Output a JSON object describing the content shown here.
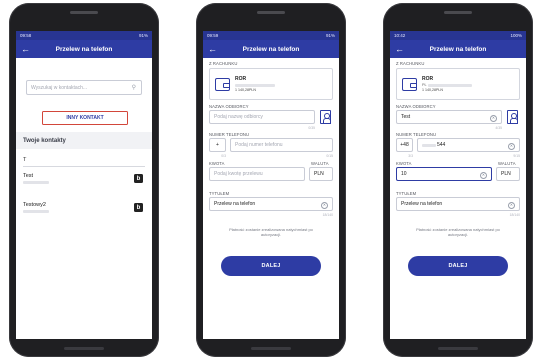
{
  "title": "Przelew na telefon",
  "screen1": {
    "status_time": "09:58",
    "status_right": "91%",
    "search_placeholder": "Wyszukaj w kontaktach...",
    "other_contact_button": "INNY KONTAKT",
    "section_title": "Twoje kontakty",
    "group_letter": "T",
    "contacts": [
      {
        "name": "Test",
        "badge": "b"
      },
      {
        "name": "Testowy2",
        "badge": "b"
      }
    ]
  },
  "screen2": {
    "status_time": "09:59",
    "status_right": "91%",
    "from_account_label": "Z RACHUNKU",
    "account_name": "ROR",
    "account_balance": "1 140,28PLN",
    "recipient_label": "NAZWA ODBIORCY",
    "recipient_placeholder": "Podaj nazwę odbiorcy",
    "recipient_counter": "0/35",
    "phone_label": "NUMER TELEFONU",
    "phone_prefix": "+",
    "phone_placeholder": "Podaj numer telefonu",
    "prefix_counter": "0/3",
    "phone_counter": "0/15",
    "amount_label": "KWOTA",
    "amount_placeholder": "Podaj kwotę przelewu",
    "currency_label": "WALUTA",
    "currency_value": "PLN",
    "title_label": "TYTUŁEM",
    "title_value": "Przelew na telefon",
    "title_counter": "18/140",
    "notice": "Płatność zostanie zrealizowana natychmiast po autoryzacji.",
    "next_button": "DALEJ"
  },
  "screen3": {
    "status_time": "10:42",
    "status_right": "100%",
    "from_account_label": "Z RACHUNKU",
    "account_name": "ROR",
    "account_number": "PL",
    "account_balance": "1 140,28PLN",
    "recipient_label": "NAZWA ODBIORCY",
    "recipient_value": "Test",
    "recipient_counter": "4/35",
    "phone_label": "NUMER TELEFONU",
    "phone_prefix": "+48",
    "phone_value": "544",
    "prefix_counter": "3/3",
    "phone_counter": "9/15",
    "amount_label": "KWOTA",
    "amount_value": "10",
    "currency_label": "WALUTA",
    "currency_value": "PLN",
    "title_label": "TYTUŁEM",
    "title_value": "Przelew na telefon",
    "title_counter": "18/140",
    "notice": "Płatność zostanie zrealizowana natychmiast po autoryzacji.",
    "next_button": "DALEJ"
  }
}
